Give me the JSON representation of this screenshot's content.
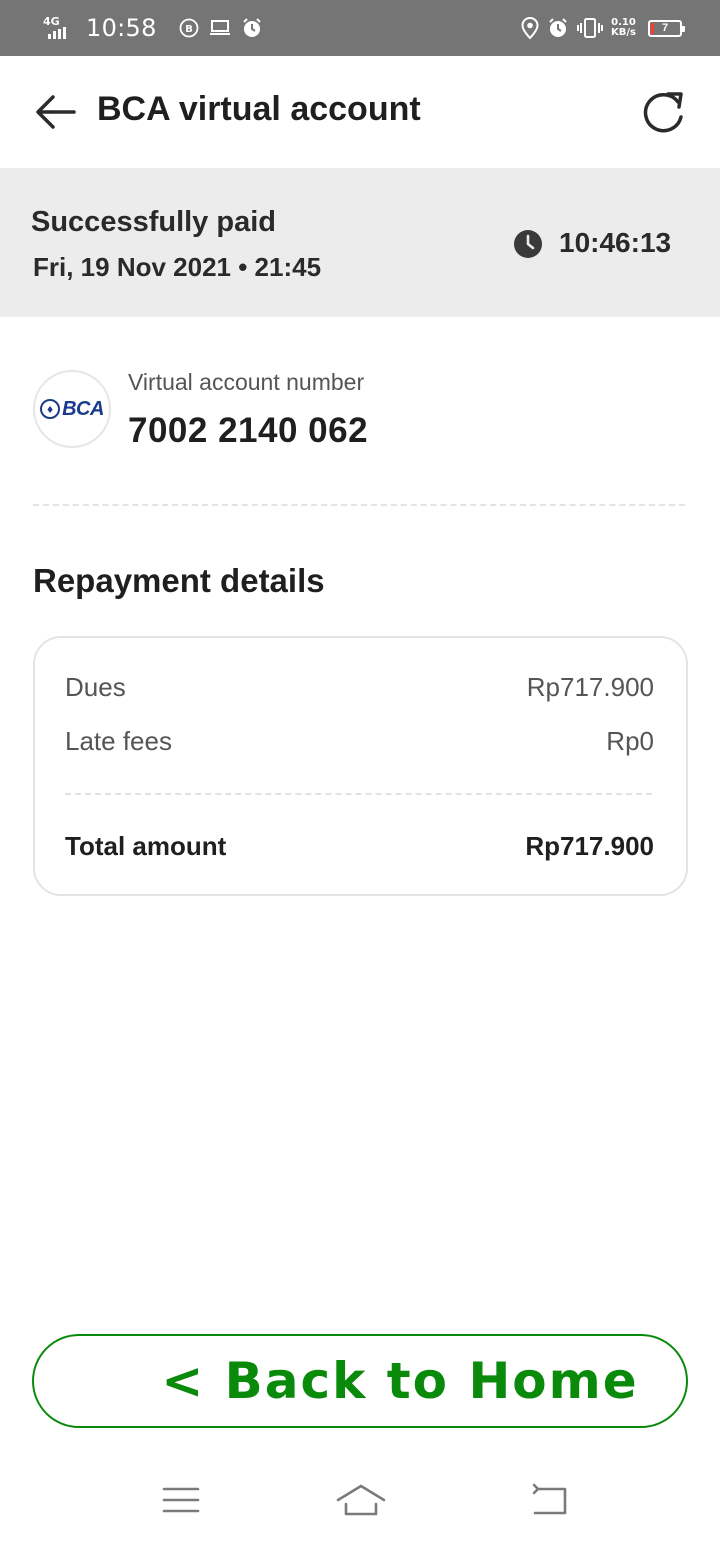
{
  "status_bar": {
    "network": "4G",
    "time": "10:58",
    "speed_value": "0.10",
    "speed_unit": "KB/s",
    "battery": "7",
    "icons": [
      "b-circle-icon",
      "laptop-icon",
      "alarm-icon",
      "location-icon",
      "alarm-icon",
      "vibrate-icon"
    ]
  },
  "header": {
    "title": "BCA virtual account",
    "back_icon": "arrow-left-icon",
    "refresh_icon": "refresh-icon"
  },
  "payment_status": {
    "label": "Successfully paid",
    "datetime": "Fri, 19 Nov 2021 • 21:45",
    "time_icon": "clock-icon",
    "time": "10:46:13"
  },
  "virtual_account": {
    "bank_logo_text": "BCA",
    "label": "Virtual account number",
    "number": "7002 2140 062"
  },
  "repayment": {
    "title": "Repayment details",
    "dues_label": "Dues",
    "dues_value": "Rp717.900",
    "late_fees_label": "Late fees",
    "late_fees_value": "Rp0",
    "total_label": "Total amount",
    "total_value": "Rp717.900"
  },
  "actions": {
    "back_home_label": "< Back to Home"
  },
  "nav": {
    "icons": [
      "menu-icon",
      "home-icon",
      "back-icon"
    ]
  },
  "colors": {
    "status_bar": "#757575",
    "banner": "#ececec",
    "accent_green": "#0a8a0a",
    "bca_blue": "#1a3b8f",
    "battery_low": "#ff3b30"
  }
}
